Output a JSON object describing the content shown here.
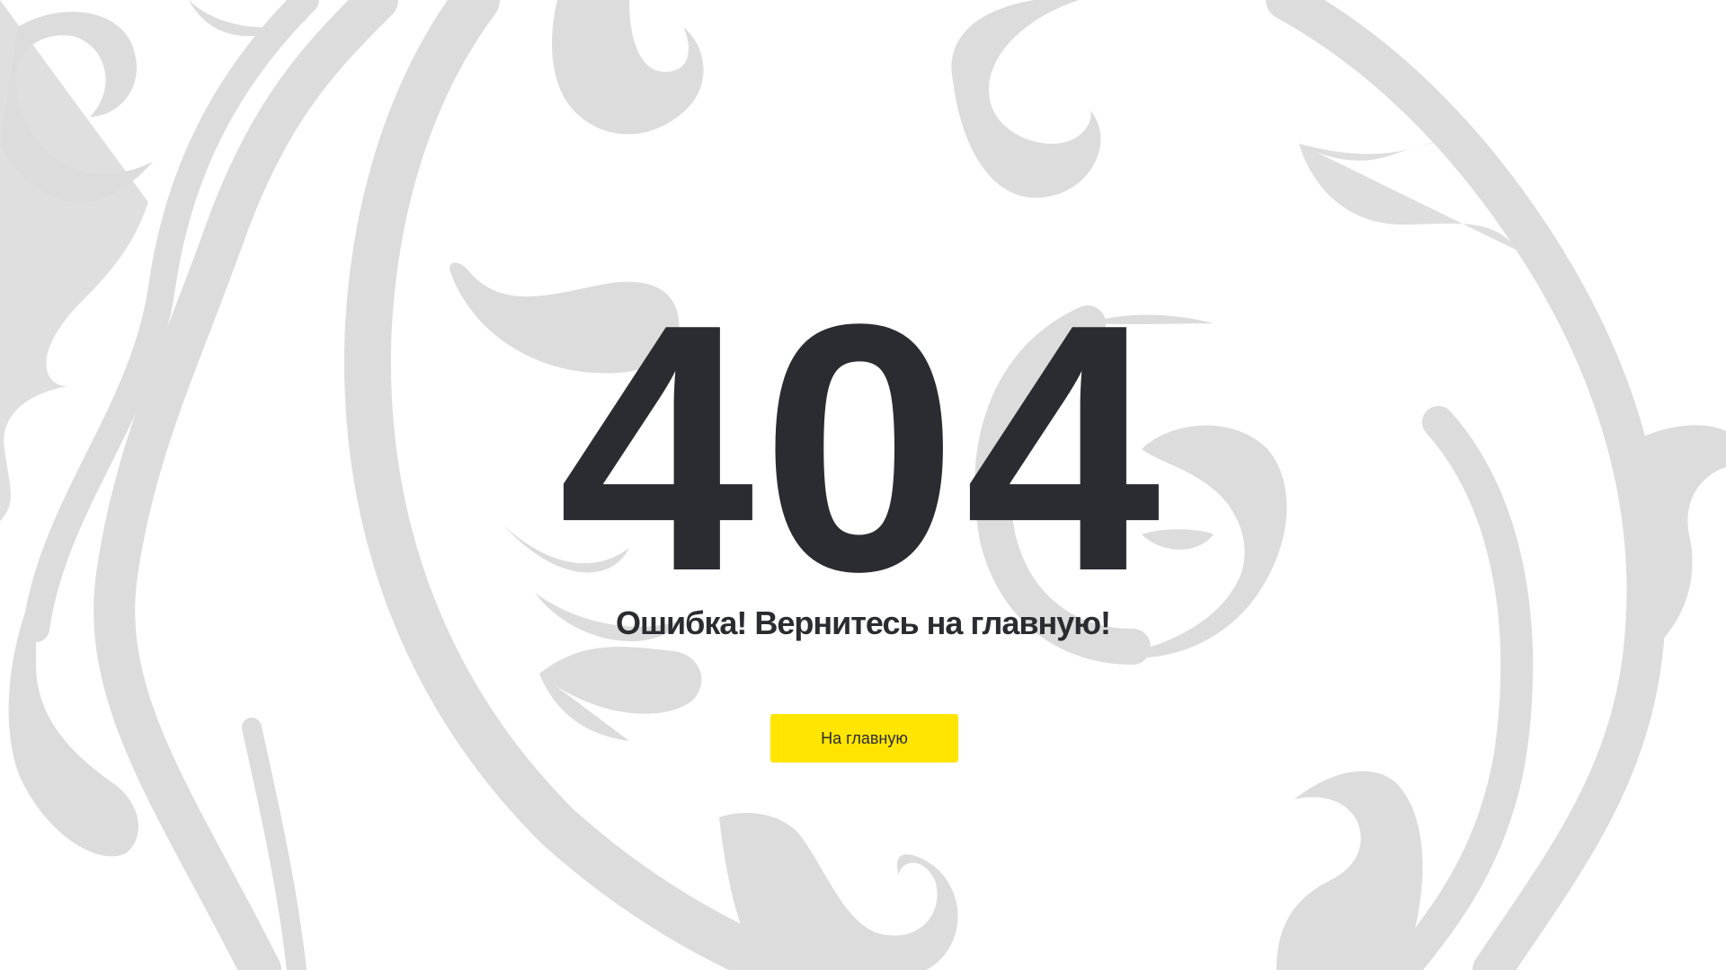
{
  "error": {
    "code": "404",
    "message": "Ошибка! Вернитесь на главную!"
  },
  "actions": {
    "home_label": "На главную"
  },
  "colors": {
    "background": "#ffffff",
    "ornament": "#dcdcdc",
    "text": "#2b2c31",
    "button_accent": "#ffe500"
  }
}
